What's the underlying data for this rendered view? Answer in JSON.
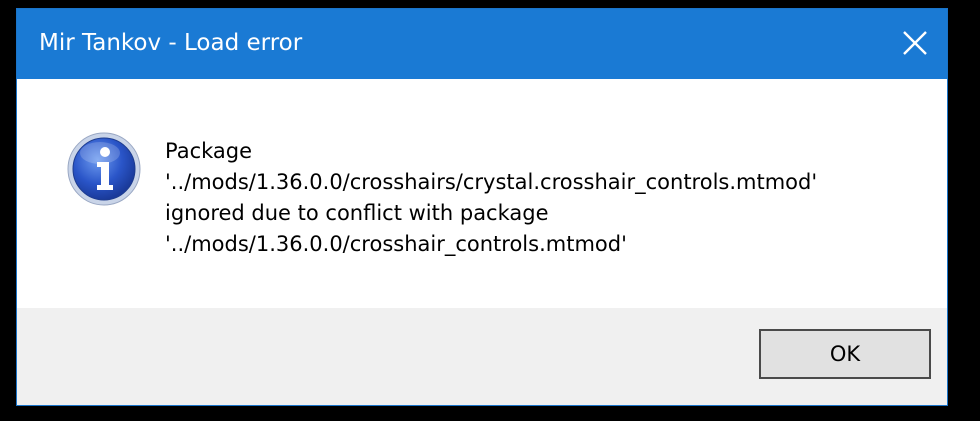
{
  "window": {
    "title": "Mir Tankov - Load error"
  },
  "icons": {
    "close": "close-icon",
    "info": "info-icon"
  },
  "message": {
    "lines": [
      "Package",
      "'../mods/1.36.0.0/crosshairs/crystal.crosshair_controls.mtmod'",
      "ignored due to conflict with package",
      "'../mods/1.36.0.0/crosshair_controls.mtmod'"
    ]
  },
  "buttons": {
    "ok_label": "OK"
  },
  "colors": {
    "titlebar": "#1a7ad4",
    "footer": "#f0f0f0",
    "info_icon_fill": "#2a55c8"
  }
}
